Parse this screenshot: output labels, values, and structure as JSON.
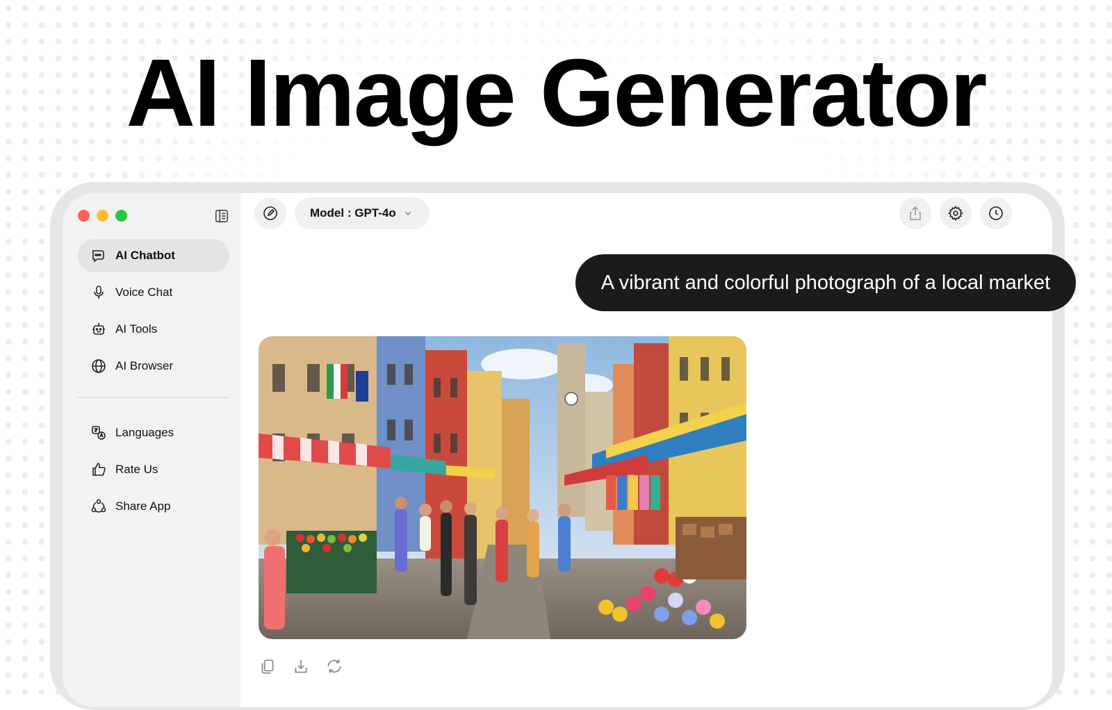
{
  "hero": {
    "title": "AI Image Generator"
  },
  "sidebar": {
    "items": [
      {
        "label": "AI Chatbot",
        "icon": "chat-bubble-icon",
        "active": true
      },
      {
        "label": "Voice Chat",
        "icon": "microphone-icon"
      },
      {
        "label": "AI Tools",
        "icon": "robot-icon"
      },
      {
        "label": "AI Browser",
        "icon": "globe-icon"
      }
    ],
    "secondary": [
      {
        "label": "Languages",
        "icon": "translate-icon"
      },
      {
        "label": "Rate Us",
        "icon": "thumbs-up-icon"
      },
      {
        "label": "Share App",
        "icon": "share-network-icon"
      }
    ]
  },
  "toolbar": {
    "model_label": "Model : GPT-4o"
  },
  "chat": {
    "prompt": "A vibrant and colorful photograph of a local market"
  },
  "colors": {
    "accent_dark": "#1b1b1b",
    "traffic_red": "#ff5f57",
    "traffic_yellow": "#febc2e",
    "traffic_green": "#28c840"
  }
}
